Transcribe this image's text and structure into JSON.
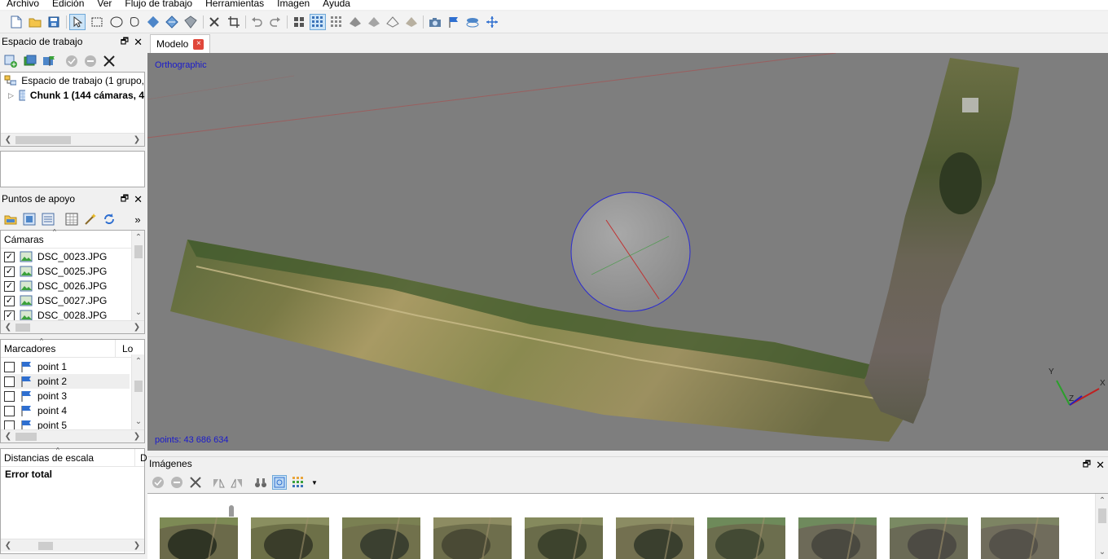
{
  "menu": [
    "Archivo",
    "Edición",
    "Ver",
    "Flujo de trabajo",
    "Herramientas",
    "Imagen",
    "Ayuda"
  ],
  "workspace": {
    "title": "Espacio de trabajo",
    "root_label": "Espacio de trabajo (1 grupo,",
    "chunk_label": "Chunk 1 (144 cámaras, 4"
  },
  "gcp": {
    "title": "Puntos de apoyo",
    "cameras_header": "Cámaras",
    "cameras": [
      {
        "name": "DSC_0023.JPG",
        "checked": true
      },
      {
        "name": "DSC_0025.JPG",
        "checked": true
      },
      {
        "name": "DSC_0026.JPG",
        "checked": true
      },
      {
        "name": "DSC_0027.JPG",
        "checked": true
      },
      {
        "name": "DSC_0028.JPG",
        "checked": true
      }
    ],
    "markers_header": "Marcadores",
    "markers_col2": "Lo",
    "markers": [
      {
        "name": "point 1",
        "checked": false
      },
      {
        "name": "point 2",
        "checked": false
      },
      {
        "name": "point 3",
        "checked": false
      },
      {
        "name": "point 4",
        "checked": false
      },
      {
        "name": "point 5",
        "checked": false
      }
    ],
    "scalebars_header": "Distancias de escala",
    "scalebars_col2": "D",
    "total_error": "Error total"
  },
  "model_tab": {
    "label": "Modelo",
    "close": "×"
  },
  "viewport": {
    "projection": "Orthographic",
    "points": "points: 43 686 634",
    "axis_x": "X",
    "axis_y": "Y",
    "axis_z": "Z"
  },
  "images_panel": {
    "title": "Imágenes"
  },
  "colors": {
    "accent": "#1a1acc",
    "viewport_bg": "#7e7e7e",
    "close_red": "#e0473a"
  }
}
